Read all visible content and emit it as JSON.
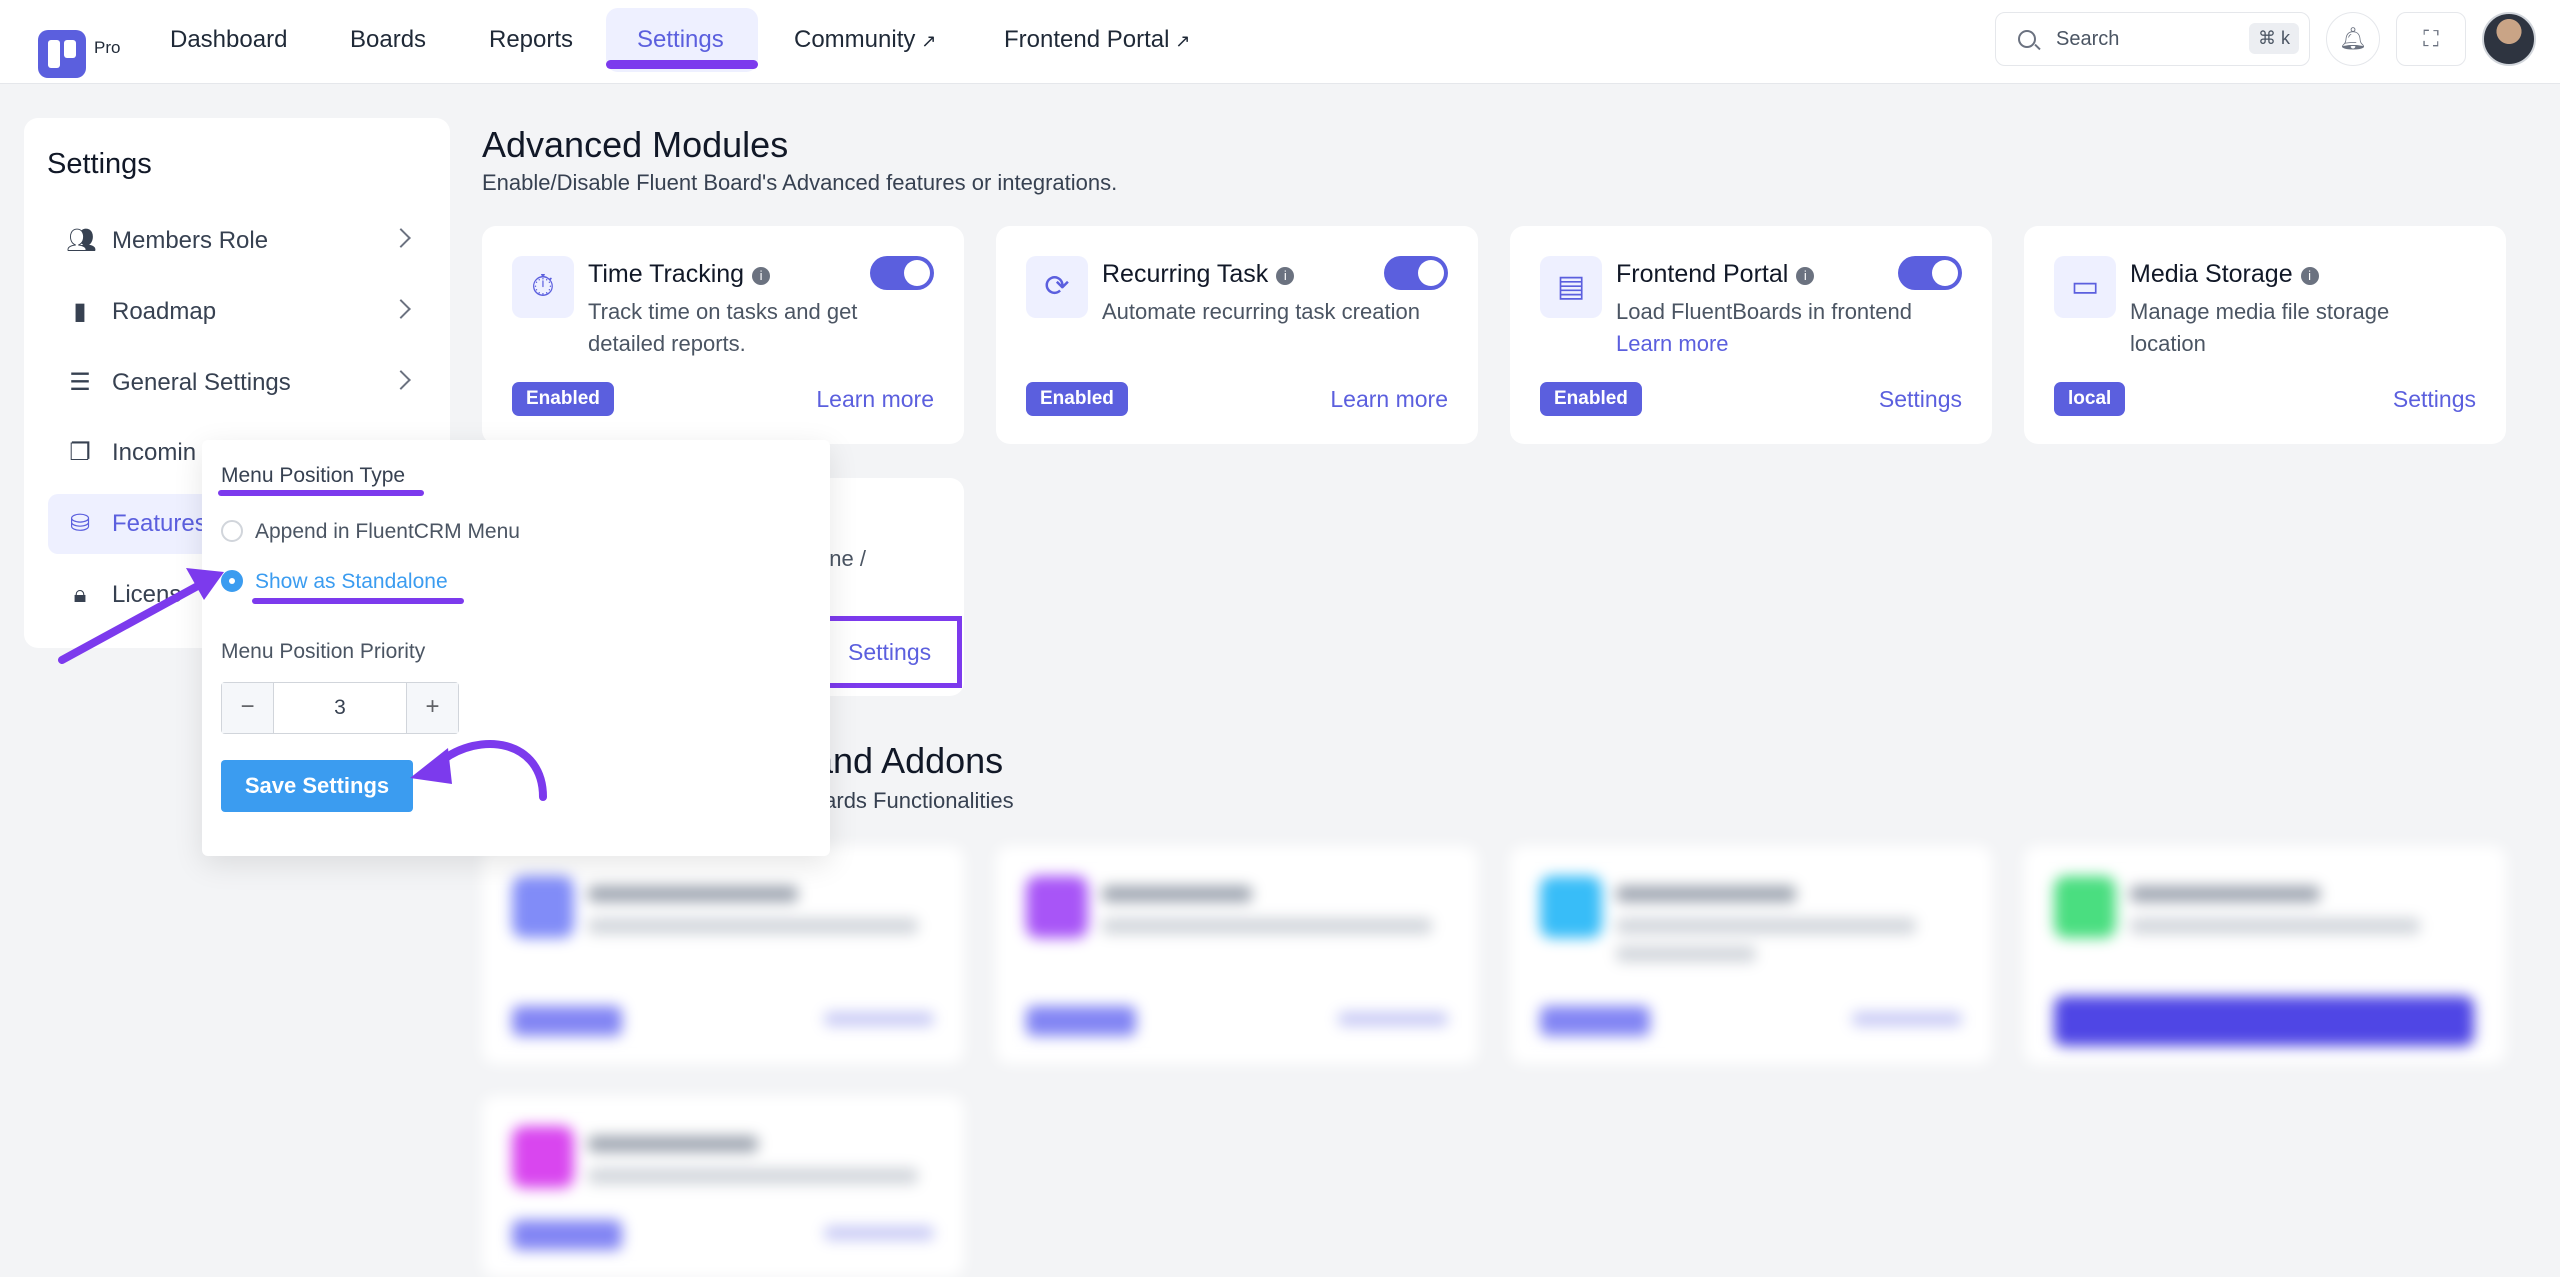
{
  "header": {
    "brand_tag": "Pro",
    "nav": [
      {
        "label": "Dashboard"
      },
      {
        "label": "Boards"
      },
      {
        "label": "Reports"
      },
      {
        "label": "Settings"
      },
      {
        "label": "Community"
      },
      {
        "label": "Frontend Portal"
      }
    ],
    "search_placeholder": "Search",
    "search_shortcut": "⌘ k"
  },
  "sidebar": {
    "title": "Settings",
    "items": [
      {
        "label": "Members Role",
        "icon": "users-icon"
      },
      {
        "label": "Roadmap",
        "icon": "bar-chart-icon"
      },
      {
        "label": "General Settings",
        "icon": "sliders-icon"
      },
      {
        "label": "Incomin",
        "icon": "copy-icon"
      },
      {
        "label": "Features",
        "icon": "features-icon"
      },
      {
        "label": "Licens",
        "icon": "lock-icon"
      }
    ]
  },
  "main": {
    "title": "Advanced Modules",
    "subtitle": "Enable/Disable Fluent Board's Advanced features or integrations.",
    "modules": [
      {
        "title": "Time Tracking",
        "desc": "Track time on tasks and get detailed reports.",
        "badge": "Enabled",
        "action": "Learn more",
        "toggle": true
      },
      {
        "title": "Recurring Task",
        "desc": "Automate recurring task creation",
        "badge": "Enabled",
        "action": "Learn more",
        "toggle": true
      },
      {
        "title": "Frontend Portal",
        "desc": "Load FluentBoards in frontend",
        "desc_link": "Learn more",
        "badge": "Enabled",
        "action": "Settings",
        "toggle": true
      },
      {
        "title": "Media Storage",
        "desc": "Manage media file storage location",
        "badge": "local",
        "action": "Settings",
        "toggle": false
      }
    ],
    "partial_card": {
      "text": "one /",
      "action": "Settings"
    },
    "addons_title": "s and Addons",
    "addons_subtitle": "t Boards Functionalities"
  },
  "popover": {
    "type_label": "Menu Position Type",
    "options": [
      {
        "label": "Append in FluentCRM Menu",
        "checked": false
      },
      {
        "label": "Show as Standalone",
        "checked": true
      }
    ],
    "priority_label": "Menu Position Priority",
    "priority_value": "3",
    "minus": "−",
    "plus": "+",
    "save_label": "Save Settings"
  },
  "colors": {
    "accent": "#5b5fde",
    "annotation": "#7c3aed",
    "primary_button": "#3b9cf0"
  }
}
